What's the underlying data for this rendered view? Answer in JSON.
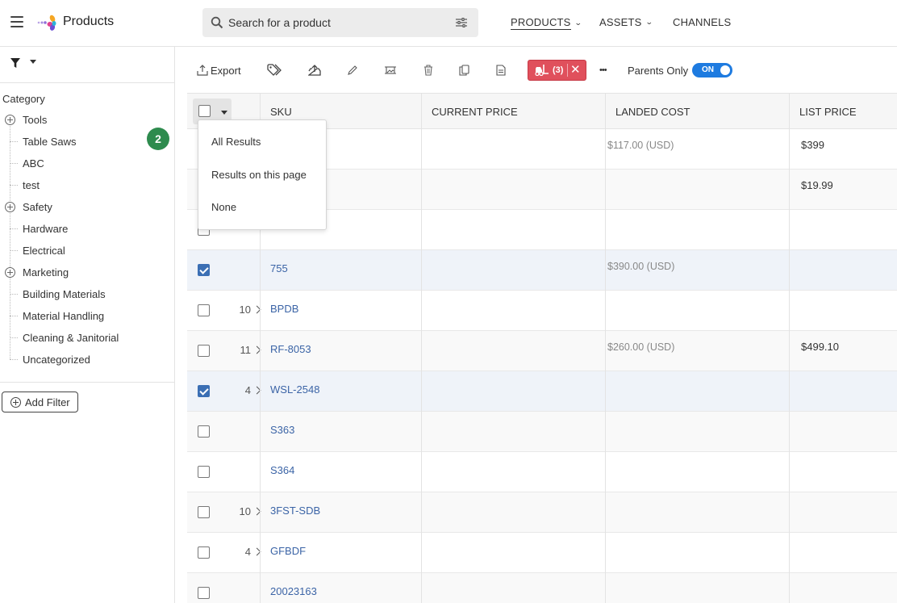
{
  "app": {
    "title": "Products"
  },
  "search": {
    "placeholder": "Search for a product"
  },
  "nav": [
    {
      "label": "PRODUCTS",
      "active": true,
      "has_dropdown": true
    },
    {
      "label": "ASSETS",
      "active": false,
      "has_dropdown": true
    },
    {
      "label": "CHANNELS",
      "active": false,
      "has_dropdown": false
    }
  ],
  "sidebar": {
    "category_title": "Category",
    "badge": "2",
    "items": [
      {
        "label": "Tools",
        "expandable": true
      },
      {
        "label": "Table Saws",
        "expandable": false
      },
      {
        "label": "ABC",
        "expandable": false
      },
      {
        "label": "test",
        "expandable": false
      },
      {
        "label": "Safety",
        "expandable": true
      },
      {
        "label": "Hardware",
        "expandable": false
      },
      {
        "label": "Electrical",
        "expandable": false
      },
      {
        "label": "Marketing",
        "expandable": true
      },
      {
        "label": "Building Materials",
        "expandable": false
      },
      {
        "label": "Material Handling",
        "expandable": false
      },
      {
        "label": "Cleaning & Janitorial",
        "expandable": false
      },
      {
        "label": "Uncategorized",
        "expandable": false
      }
    ],
    "add_filter_label": "Add Filter"
  },
  "toolbar": {
    "export_label": "Export",
    "forklift_count": "(3)",
    "more_label": "•••",
    "parents_only_label": "Parents Only",
    "toggle_label": "ON"
  },
  "grid": {
    "columns": [
      "SKU",
      "CURRENT PRICE",
      "LANDED COST",
      "LIST PRICE"
    ],
    "rows": [
      {
        "checked": false,
        "children": "",
        "sku": "",
        "landed": "$117.00 (USD)",
        "list": "$399"
      },
      {
        "checked": false,
        "children": "",
        "sku": "",
        "landed": "",
        "list": "$19.99"
      },
      {
        "checked": false,
        "children": "",
        "sku": "",
        "landed": "",
        "list": ""
      },
      {
        "checked": true,
        "children": "",
        "sku": "755",
        "landed": "$390.00 (USD)",
        "list": ""
      },
      {
        "checked": false,
        "children": "10",
        "sku": "BPDB",
        "landed": "",
        "list": ""
      },
      {
        "checked": false,
        "children": "11",
        "sku": "RF-8053",
        "landed": "$260.00 (USD)",
        "list": "$499.10"
      },
      {
        "checked": true,
        "children": "4",
        "sku": "WSL-2548",
        "landed": "",
        "list": ""
      },
      {
        "checked": false,
        "children": "",
        "sku": "S363",
        "landed": "",
        "list": ""
      },
      {
        "checked": false,
        "children": "",
        "sku": "S364",
        "landed": "",
        "list": ""
      },
      {
        "checked": false,
        "children": "10",
        "sku": "3FST-SDB",
        "landed": "",
        "list": ""
      },
      {
        "checked": false,
        "children": "4",
        "sku": "GFBDF",
        "landed": "",
        "list": ""
      },
      {
        "checked": false,
        "children": "",
        "sku": "20023163",
        "landed": "",
        "list": ""
      }
    ]
  },
  "select_menu": {
    "items": [
      "All Results",
      "Results on this page",
      "None"
    ]
  },
  "colors": {
    "accent": "#1e7be0",
    "link": "#3b64a6",
    "danger": "#e0505c",
    "badge": "#2e8b4e"
  }
}
